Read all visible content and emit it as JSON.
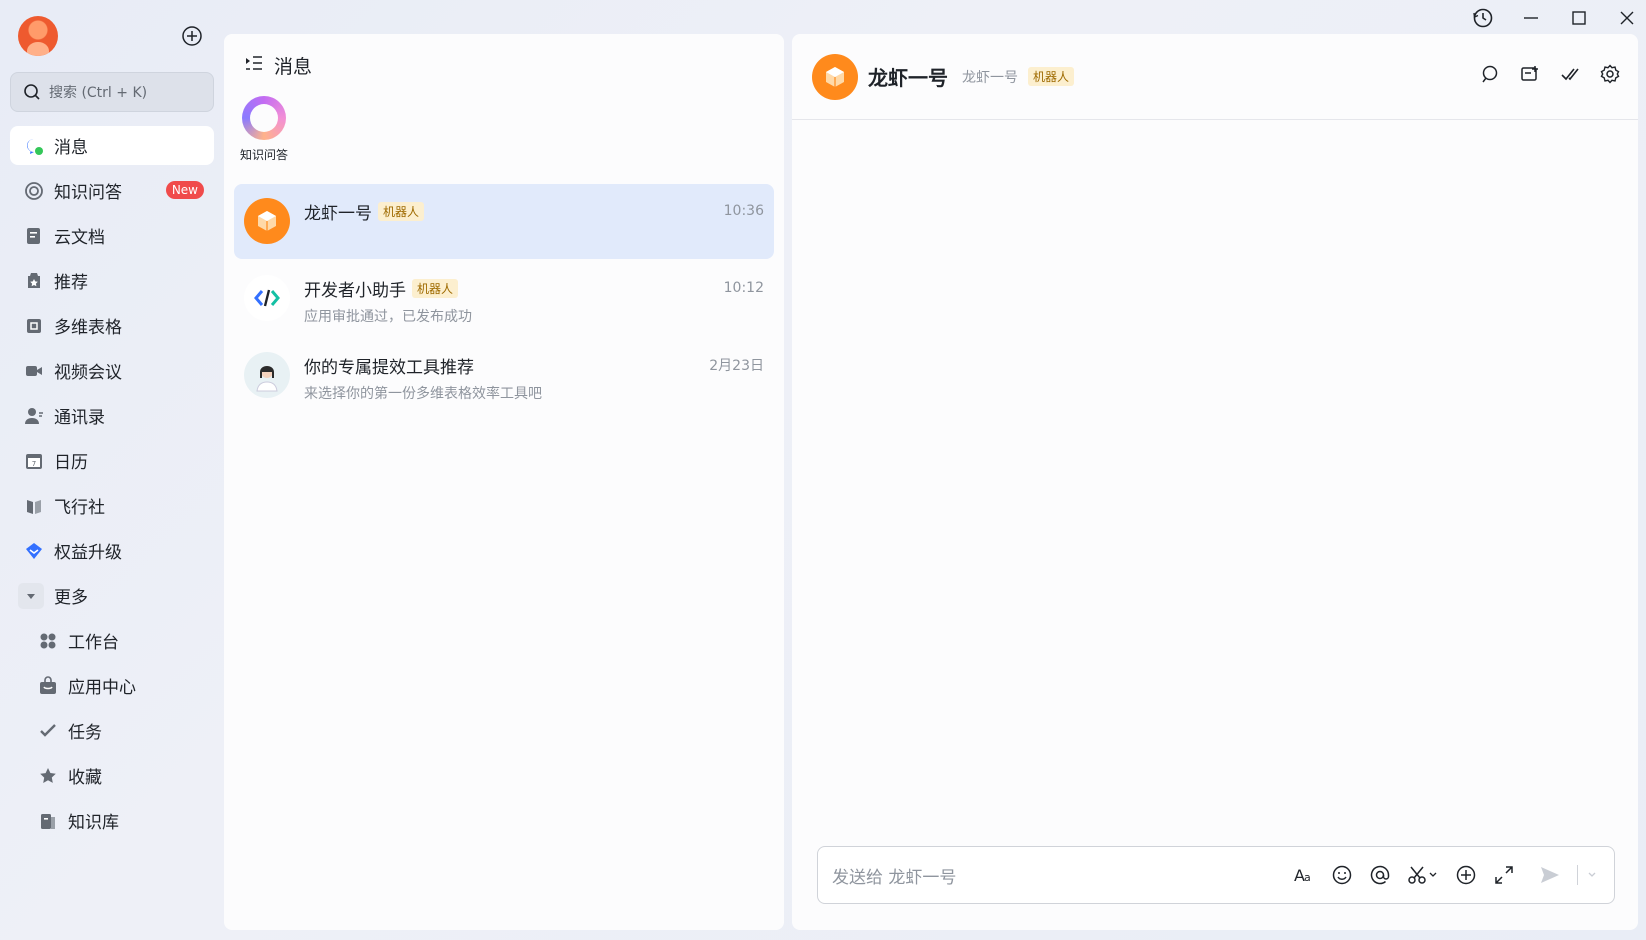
{
  "sidebar": {
    "search_placeholder": "搜索 (Ctrl + K)",
    "items": [
      {
        "label": "消息",
        "icon": "chat-bubble-icon",
        "active": true
      },
      {
        "label": "知识问答",
        "icon": "knowledge-qa-icon",
        "badge": "New"
      },
      {
        "label": "云文档",
        "icon": "cloud-doc-icon"
      },
      {
        "label": "推荐",
        "icon": "recommend-icon"
      },
      {
        "label": "多维表格",
        "icon": "base-table-icon"
      },
      {
        "label": "视频会议",
        "icon": "video-meeting-icon"
      },
      {
        "label": "通讯录",
        "icon": "contacts-icon"
      },
      {
        "label": "日历",
        "icon": "calendar-icon"
      },
      {
        "label": "飞行社",
        "icon": "feixing-icon"
      },
      {
        "label": "权益升级",
        "icon": "upgrade-diamond-icon"
      },
      {
        "label": "更多",
        "icon": "collapse-arrow-icon"
      }
    ],
    "more_items": [
      {
        "label": "工作台",
        "icon": "workplace-icon"
      },
      {
        "label": "应用中心",
        "icon": "app-center-icon"
      },
      {
        "label": "任务",
        "icon": "task-icon"
      },
      {
        "label": "收藏",
        "icon": "star-icon"
      },
      {
        "label": "知识库",
        "icon": "wiki-icon"
      }
    ]
  },
  "list_panel": {
    "title": "消息",
    "quick_access": {
      "label": "知识问答"
    },
    "conversations": [
      {
        "name": "龙虾一号",
        "tag": "机器人",
        "time": "10:36",
        "preview": "",
        "active": true
      },
      {
        "name": "开发者小助手",
        "tag": "机器人",
        "time": "10:12",
        "preview": "应用审批通过，已发布成功"
      },
      {
        "name": "你的专属提效工具推荐",
        "tag": "",
        "time": "2月23日",
        "preview": "来选择你的第一份多维表格效率工具吧"
      }
    ]
  },
  "chat": {
    "title": "龙虾一号",
    "subtitle": "龙虾一号",
    "tag": "机器人",
    "composer_placeholder": "发送给 龙虾一号"
  },
  "colors": {
    "accent": "#3370ff",
    "bot_orange": "#ff8a1c",
    "active_row": "#e1eafb",
    "tag_bg": "#fcefcf"
  }
}
